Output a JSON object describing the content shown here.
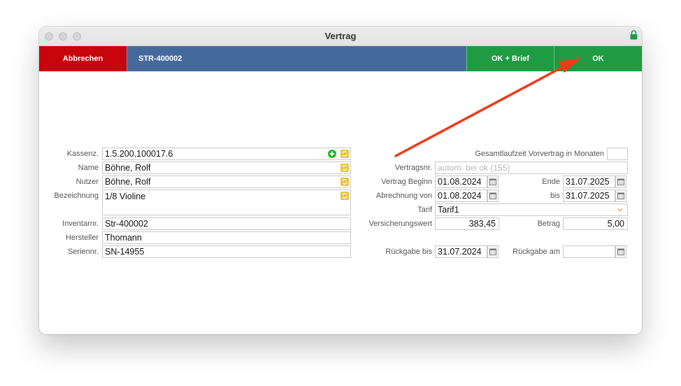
{
  "window": {
    "title": "Vertrag"
  },
  "toolbar": {
    "cancel_label": "Abbrechen",
    "record_label": "STR-400002",
    "ok_brief_label": "OK + Brief",
    "ok_label": "OK"
  },
  "left": {
    "kassenz": {
      "label": "Kassenz.",
      "value": "1.5.200.100017.6"
    },
    "name": {
      "label": "Name",
      "value": "Böhne, Rolf"
    },
    "nutzer": {
      "label": "Nutzer",
      "value": "Böhne, Rolf"
    },
    "bezeichnung": {
      "label": "Bezeichnung",
      "value": "1/8 Violine"
    },
    "inventarnr": {
      "label": "Inventarnr.",
      "value": "Str-400002"
    },
    "hersteller": {
      "label": "Hersteller",
      "value": "Thomann"
    },
    "seriennr": {
      "label": "Seriennr.",
      "value": "SN-14955"
    }
  },
  "right": {
    "gesamtlaufzeit": {
      "label": "Gesamtlaufzeit Vorvertrag in Monaten",
      "value": ""
    },
    "vertragsnr": {
      "label": "Vertragsnr.",
      "placeholder": "autom. bei ok (155)"
    },
    "vertrag_beginn": {
      "label": "Vertrag Beginn",
      "value": "01.08.2024"
    },
    "ende": {
      "label": "Ende",
      "value": "31.07.2025"
    },
    "abrechnung_von": {
      "label": "Abrechnung von",
      "value": "01.08.2024"
    },
    "bis": {
      "label": "bis",
      "value": "31.07.2025"
    },
    "tarif": {
      "label": "Tarif",
      "value": "Tarif1"
    },
    "versicherungswert": {
      "label": "Versicherungswert",
      "value": "383,45"
    },
    "betrag": {
      "label": "Betrag",
      "value": "5,00"
    },
    "rueckgabe_bis": {
      "label": "Rückgabe bis",
      "value": "31.07.2024"
    },
    "rueckgabe_am": {
      "label": "Rückgabe am",
      "value": ""
    }
  },
  "icons": {
    "add": "plus-circle-icon",
    "lookup": "refresh-icon",
    "calendar": "calendar-icon",
    "dropdown": "chevron-down-icon",
    "lock": "lock-icon"
  },
  "colors": {
    "cancel": "#c8040d",
    "record": "#46699c",
    "ok": "#1f9b43",
    "annotation_arrow": "#f03a17"
  }
}
